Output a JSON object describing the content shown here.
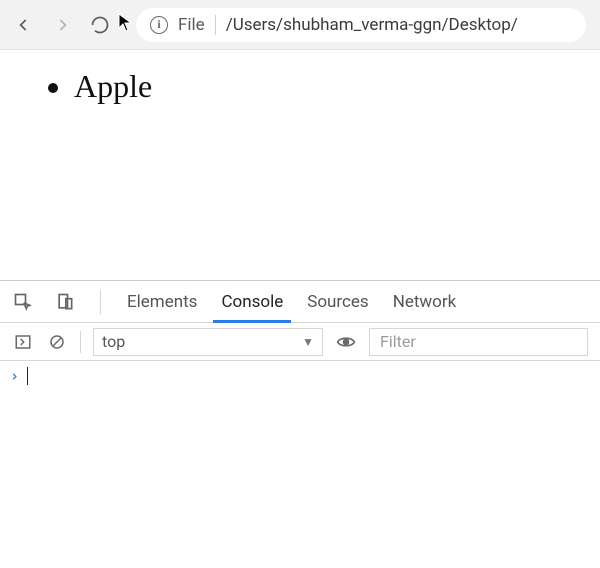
{
  "toolbar": {
    "file_label": "File",
    "path": "/Users/shubham_verma-ggn/Desktop/"
  },
  "page": {
    "items": [
      "Apple"
    ]
  },
  "devtools": {
    "tabs": {
      "elements": "Elements",
      "console": "Console",
      "sources": "Sources",
      "network": "Network"
    },
    "console": {
      "context": "top",
      "filter_placeholder": "Filter",
      "prompt": "›"
    }
  }
}
